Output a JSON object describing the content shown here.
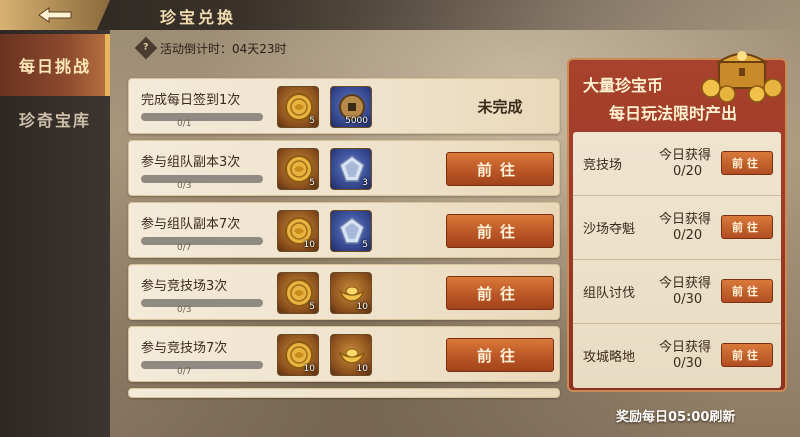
{
  "header": {
    "title": "珍宝兑换",
    "back_icon": "back-arrow-icon"
  },
  "sidebar": {
    "tabs": [
      {
        "label": "每日挑战",
        "active": true
      },
      {
        "label": "珍奇宝库",
        "active": false
      }
    ]
  },
  "countdown": {
    "icon": "hourglass-icon",
    "text": "活动倒计时：04天23时"
  },
  "tasks": [
    {
      "name": "完成每日签到1次",
      "progress_text": "0/1",
      "progress": 0,
      "rewards": [
        {
          "icon": "gold-coin-icon",
          "qty": "5"
        },
        {
          "icon": "copper-coin-icon",
          "qty": "5000"
        }
      ],
      "status": "未完成"
    },
    {
      "name": "参与组队副本3次",
      "progress_text": "0/3",
      "progress": 0,
      "rewards": [
        {
          "icon": "gold-coin-icon",
          "qty": "5"
        },
        {
          "icon": "silver-gem-icon",
          "qty": "3"
        }
      ],
      "button": "前往"
    },
    {
      "name": "参与组队副本7次",
      "progress_text": "0/7",
      "progress": 0,
      "rewards": [
        {
          "icon": "gold-coin-icon",
          "qty": "10"
        },
        {
          "icon": "silver-gem-icon",
          "qty": "5"
        }
      ],
      "button": "前往"
    },
    {
      "name": "参与竞技场3次",
      "progress_text": "0/3",
      "progress": 0,
      "rewards": [
        {
          "icon": "gold-coin-icon",
          "qty": "5"
        },
        {
          "icon": "gold-ingot-icon",
          "qty": "10"
        }
      ],
      "button": "前往"
    },
    {
      "name": "参与竞技场7次",
      "progress_text": "0/7",
      "progress": 0,
      "rewards": [
        {
          "icon": "gold-coin-icon",
          "qty": "10"
        },
        {
          "icon": "gold-ingot-icon",
          "qty": "10"
        }
      ],
      "button": "前往"
    }
  ],
  "side_panel": {
    "title_line1": "大量珍宝币",
    "title_line2": "每日玩法限时产出",
    "earned_label": "今日获得",
    "modes": [
      {
        "name": "竞技场",
        "earned": "0/20",
        "button": "前往"
      },
      {
        "name": "沙场夺魁",
        "earned": "0/20",
        "button": "前往"
      },
      {
        "name": "组队讨伐",
        "earned": "0/30",
        "button": "前往"
      },
      {
        "name": "攻城略地",
        "earned": "0/30",
        "button": "前往"
      }
    ]
  },
  "footer": {
    "refresh_note": "奖励每日05:00刷新"
  }
}
